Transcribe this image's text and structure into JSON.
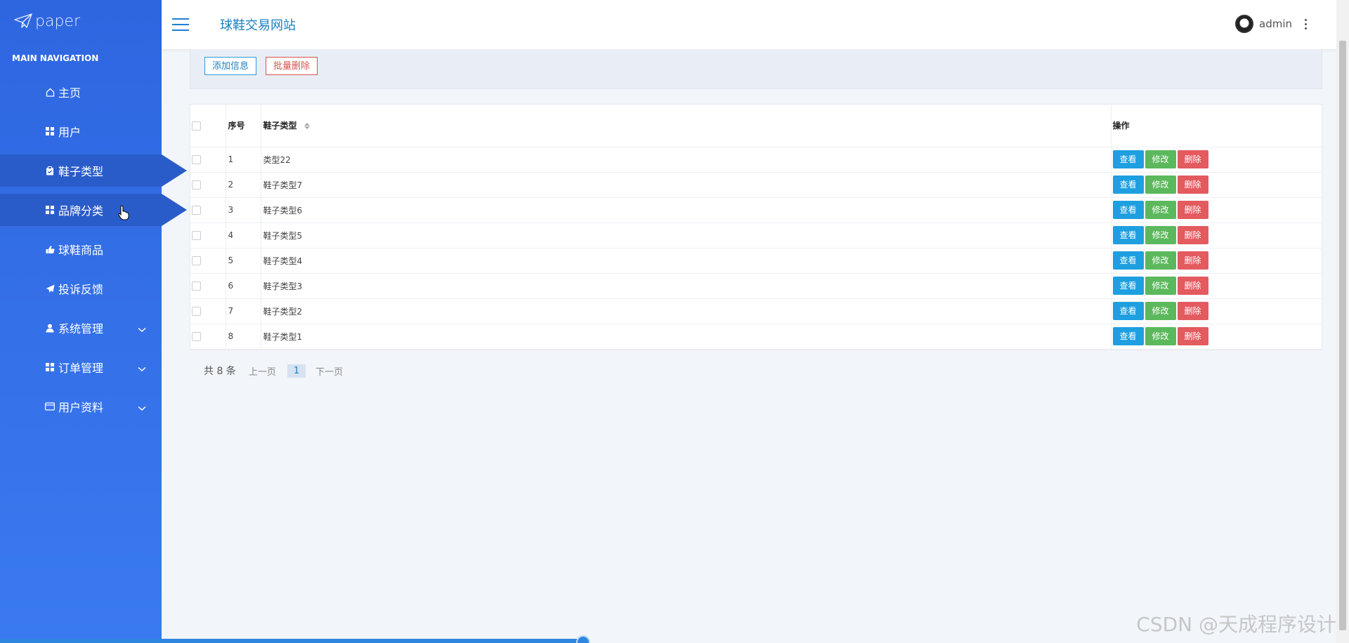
{
  "app": {
    "logo_text": "paper",
    "site_title": "球鞋交易网站",
    "user_name": "admin"
  },
  "sidebar": {
    "section_title": "MAIN NAVIGATION",
    "items": [
      {
        "label": "主页",
        "icon": "home-icon"
      },
      {
        "label": "用户",
        "icon": "grid-icon"
      },
      {
        "label": "鞋子类型",
        "icon": "clipboard-icon",
        "state": "active"
      },
      {
        "label": "品牌分类",
        "icon": "grid-icon",
        "state": "hover"
      },
      {
        "label": "球鞋商品",
        "icon": "thumbs-up-icon"
      },
      {
        "label": "投诉反馈",
        "icon": "send-icon"
      },
      {
        "label": "系统管理",
        "icon": "user-icon",
        "expandable": true
      },
      {
        "label": "订单管理",
        "icon": "grid-icon",
        "expandable": true
      },
      {
        "label": "用户资料",
        "icon": "card-icon",
        "expandable": true
      }
    ]
  },
  "toolbar": {
    "add_label": "添加信息",
    "batch_delete_label": "批量删除"
  },
  "table": {
    "headers": {
      "index": "序号",
      "type": "鞋子类型",
      "ops": "操作"
    },
    "rows": [
      {
        "index": "1",
        "type": "类型22"
      },
      {
        "index": "2",
        "type": "鞋子类型7"
      },
      {
        "index": "3",
        "type": "鞋子类型6"
      },
      {
        "index": "4",
        "type": "鞋子类型5"
      },
      {
        "index": "5",
        "type": "鞋子类型4"
      },
      {
        "index": "6",
        "type": "鞋子类型3"
      },
      {
        "index": "7",
        "type": "鞋子类型2"
      },
      {
        "index": "8",
        "type": "鞋子类型1"
      }
    ],
    "op_labels": {
      "view": "查看",
      "edit": "修改",
      "delete": "删除"
    }
  },
  "pager": {
    "total": "共 8 条",
    "prev": "上一页",
    "current": "1",
    "next": "下一页"
  },
  "watermark": "CSDN @天成程序设计",
  "colors": {
    "sidebar": "#2e66e0",
    "accent": "#1a7fc0",
    "view_button": "#1e9fe0",
    "edit_button": "#5cb85c",
    "delete_button": "#e35a5f"
  }
}
